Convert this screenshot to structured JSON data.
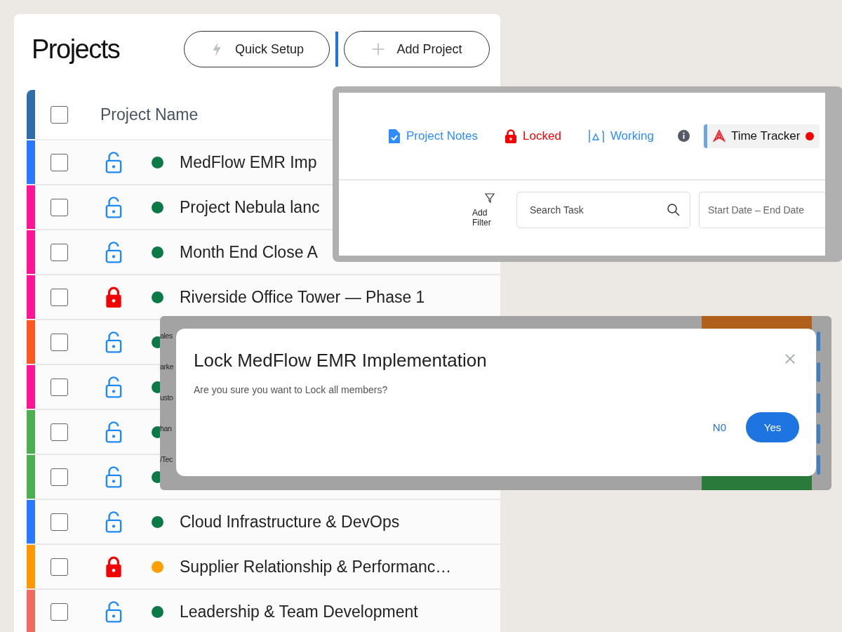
{
  "page": {
    "title": "Projects",
    "buttons": [
      {
        "label": "Quick Setup",
        "kind": "quick"
      },
      {
        "label": "Add Project",
        "kind": "add"
      }
    ]
  },
  "table": {
    "header": {
      "label": "Project Name",
      "checked": false,
      "color": "#2f6ea8"
    },
    "rows": [
      {
        "name": "MedFlow EMR Imp",
        "color": "#2979ff",
        "locked": false,
        "status": {
          "color": "#0b7a45"
        },
        "checked": false
      },
      {
        "name": "Project Nebula lanc",
        "color": "#ff1493",
        "locked": false,
        "status": {
          "color": "#0b7a45"
        },
        "checked": false
      },
      {
        "name": "Month End Close A",
        "color": "#ff1493",
        "locked": false,
        "status": {
          "color": "#0b7a45"
        },
        "checked": false
      },
      {
        "name": "Riverside Office Tower — Phase 1",
        "color": "#ff1493",
        "locked": true,
        "status": {
          "color": "#0b7a45"
        },
        "checked": false
      },
      {
        "color": "#ff5722",
        "locked": false,
        "status": {
          "color": "#0b7a45"
        },
        "checked": false
      },
      {
        "color": "#ff1493",
        "locked": false,
        "status": {
          "color": "#0b7a45"
        },
        "checked": false
      },
      {
        "color": "#4caf50",
        "locked": false,
        "status": {
          "color": "#0b7a45"
        },
        "checked": false
      },
      {
        "color": "#4caf50",
        "locked": false,
        "status": {
          "color": "#0b7a45"
        },
        "checked": false
      },
      {
        "name": "Cloud Infrastructure & DevOps",
        "color": "#2979ff",
        "locked": false,
        "status": {
          "color": "#0b7a45"
        },
        "checked": false
      },
      {
        "name": "Supplier Relationship & Performanc…",
        "color": "#ff9800",
        "locked": true,
        "status": {
          "color": "#ffa000"
        },
        "checked": false
      },
      {
        "name": "Leadership & Team Development",
        "color": "#f06a5f",
        "locked": false,
        "status": {
          "color": "#0b7a45"
        },
        "checked": false
      }
    ]
  },
  "toolbar": {
    "tabs": [
      {
        "label": "Project Notes",
        "kind": "notes",
        "selected": false
      },
      {
        "label": "Locked",
        "kind": "locked",
        "selected": false
      },
      {
        "label": "Working",
        "kind": "working",
        "selected": false
      },
      {
        "label": "Time Tracker",
        "kind": "tracker",
        "selected": true
      }
    ],
    "filter": {
      "label": "Add Filter"
    },
    "search": {
      "placeholder": "Search Task"
    },
    "date_range": {
      "placeholder": "Start Date – End Date"
    }
  },
  "backdrop": {
    "fragments": [
      "ales",
      "arke",
      "usto",
      "han",
      "/Tec"
    ]
  },
  "dialog": {
    "title": "Lock MedFlow EMR Implementation",
    "message": "Are you sure you want to Lock all members?",
    "buttons": [
      {
        "label": "N0",
        "kind": "text"
      },
      {
        "label": "Yes",
        "kind": "primary"
      }
    ]
  }
}
